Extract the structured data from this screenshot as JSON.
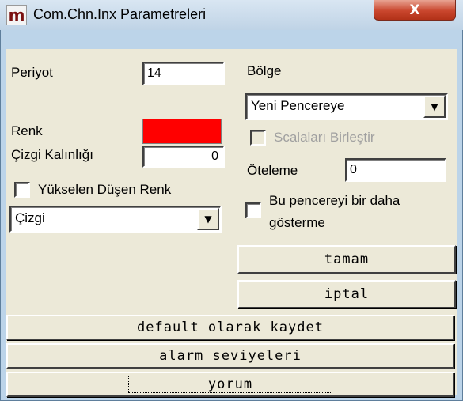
{
  "window": {
    "title": "Com.Chn.Inx Parametreleri",
    "app_icon_glyph": "m",
    "close_glyph": "X",
    "close_color": "#c9462d"
  },
  "left": {
    "periyot_label": "Periyot",
    "periyot_value": "14",
    "renk_label": "Renk",
    "renk_color": "#ff0000",
    "cizgi_kalinligi_label": "Çizgi Kalınlığı",
    "cizgi_kalinligi_value": "0",
    "yukselen_dusen_label": "Yükselen Düşen Renk",
    "yukselen_dusen_checked": false,
    "style_combo_value": "Çizgi"
  },
  "right": {
    "bolge_label": "Bölge",
    "bolge_value": "Yeni Pencereye",
    "scalalari_label": "Scalaları Birleştir",
    "scalalari_enabled": false,
    "oteleme_label": "Öteleme",
    "oteleme_value": "0",
    "bu_pencere_label_line1": "Bu pencereyi bir daha",
    "bu_pencere_label_line2": "gösterme",
    "bu_pencere_checked": false
  },
  "buttons": {
    "tamam": "tamam",
    "iptal": "iptal",
    "default_kaydet": "default olarak kaydet",
    "alarm_seviyeleri": "alarm seviyeleri",
    "yorum": "yorum"
  },
  "icons": {
    "dropdown_arrow": "▼",
    "dropdown_icon_name": "chevron-down-icon"
  }
}
